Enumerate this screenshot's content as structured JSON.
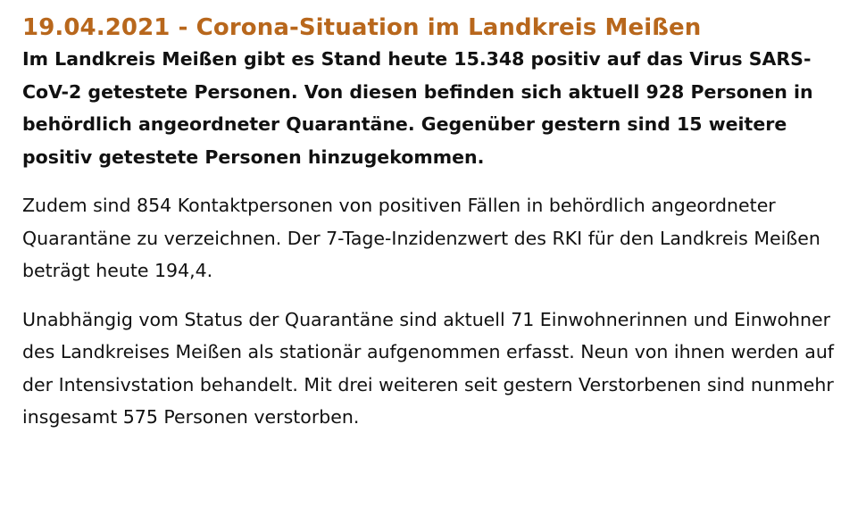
{
  "article": {
    "headline": "19.04.2021 - Corona-Situation im Landkreis Meißen",
    "lead": "Im Landkreis Meißen gibt es Stand heute 15.348 positiv auf das Virus SARS-CoV-2 getestete Personen. Von diesen befinden sich aktuell 928 Personen in behördlich angeordneter Quarantäne. Gegenüber gestern sind 15 weitere positiv getestete Personen hinzugekommen.",
    "paragraphs": [
      "Zudem sind 854 Kontaktpersonen von positiven Fällen in behördlich angeordneter Quarantäne zu verzeichnen. Der 7-Tage-Inzidenzwert des RKI für den Landkreis Meißen beträgt heute 194,4.",
      "Unabhängig vom Status der Quarantäne sind aktuell 71 Einwohnerinnen und Einwohner des Landkreises Meißen als stationär aufgenommen erfasst. Neun von ihnen werden auf der Intensivstation behandelt. Mit drei weiteren seit gestern Verstorbenen sind nunmehr insgesamt 575 Personen verstorben."
    ]
  },
  "colors": {
    "headline": "#b8671c",
    "text": "#111111",
    "background": "#ffffff"
  }
}
